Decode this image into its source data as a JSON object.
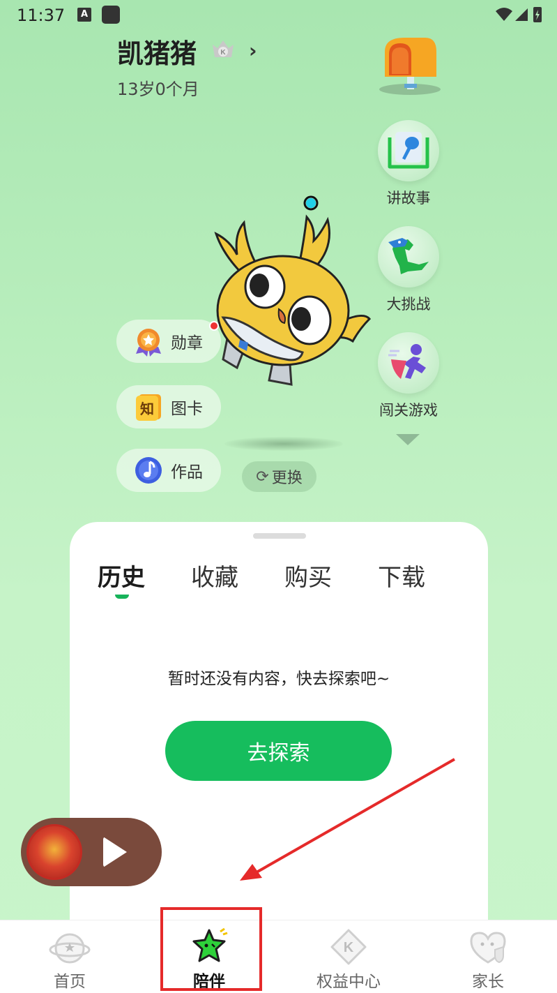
{
  "status_bar": {
    "time": "11:37",
    "icons": [
      "notification-a-icon",
      "app-square-icon",
      "wifi-icon",
      "signal-icon",
      "battery-icon"
    ]
  },
  "profile": {
    "name": "凯猪猪",
    "age": "13岁0个月"
  },
  "side_actions": [
    {
      "label": "讲故事",
      "icon": "microphone-book-icon"
    },
    {
      "label": "大挑战",
      "icon": "dinosaur-icon"
    },
    {
      "label": "闯关游戏",
      "icon": "running-figure-icon"
    }
  ],
  "left_pills": [
    {
      "label": "勋章",
      "icon": "medal-icon"
    },
    {
      "label": "图卡",
      "icon": "knowledge-card-icon",
      "icon_text": "知"
    },
    {
      "label": "作品",
      "icon": "music-note-icon"
    }
  ],
  "change_button": {
    "label": "更换"
  },
  "panel": {
    "tabs": [
      "历史",
      "收藏",
      "购买",
      "下载"
    ],
    "active_tab": "历史",
    "empty_message": "暂时还没有内容，快去探索吧~",
    "explore_label": "去探索"
  },
  "bottom_nav": [
    {
      "label": "首页",
      "icon": "planet-icon",
      "active": false
    },
    {
      "label": "陪伴",
      "icon": "green-star-icon",
      "active": true
    },
    {
      "label": "权益中心",
      "icon": "k-diamond-icon",
      "active": false
    },
    {
      "label": "家长",
      "icon": "parent-shield-icon",
      "active": false
    }
  ],
  "colors": {
    "accent_green": "#16bd5d",
    "annotation_red": "#e52a2a",
    "background_green": "#b9eebd"
  }
}
